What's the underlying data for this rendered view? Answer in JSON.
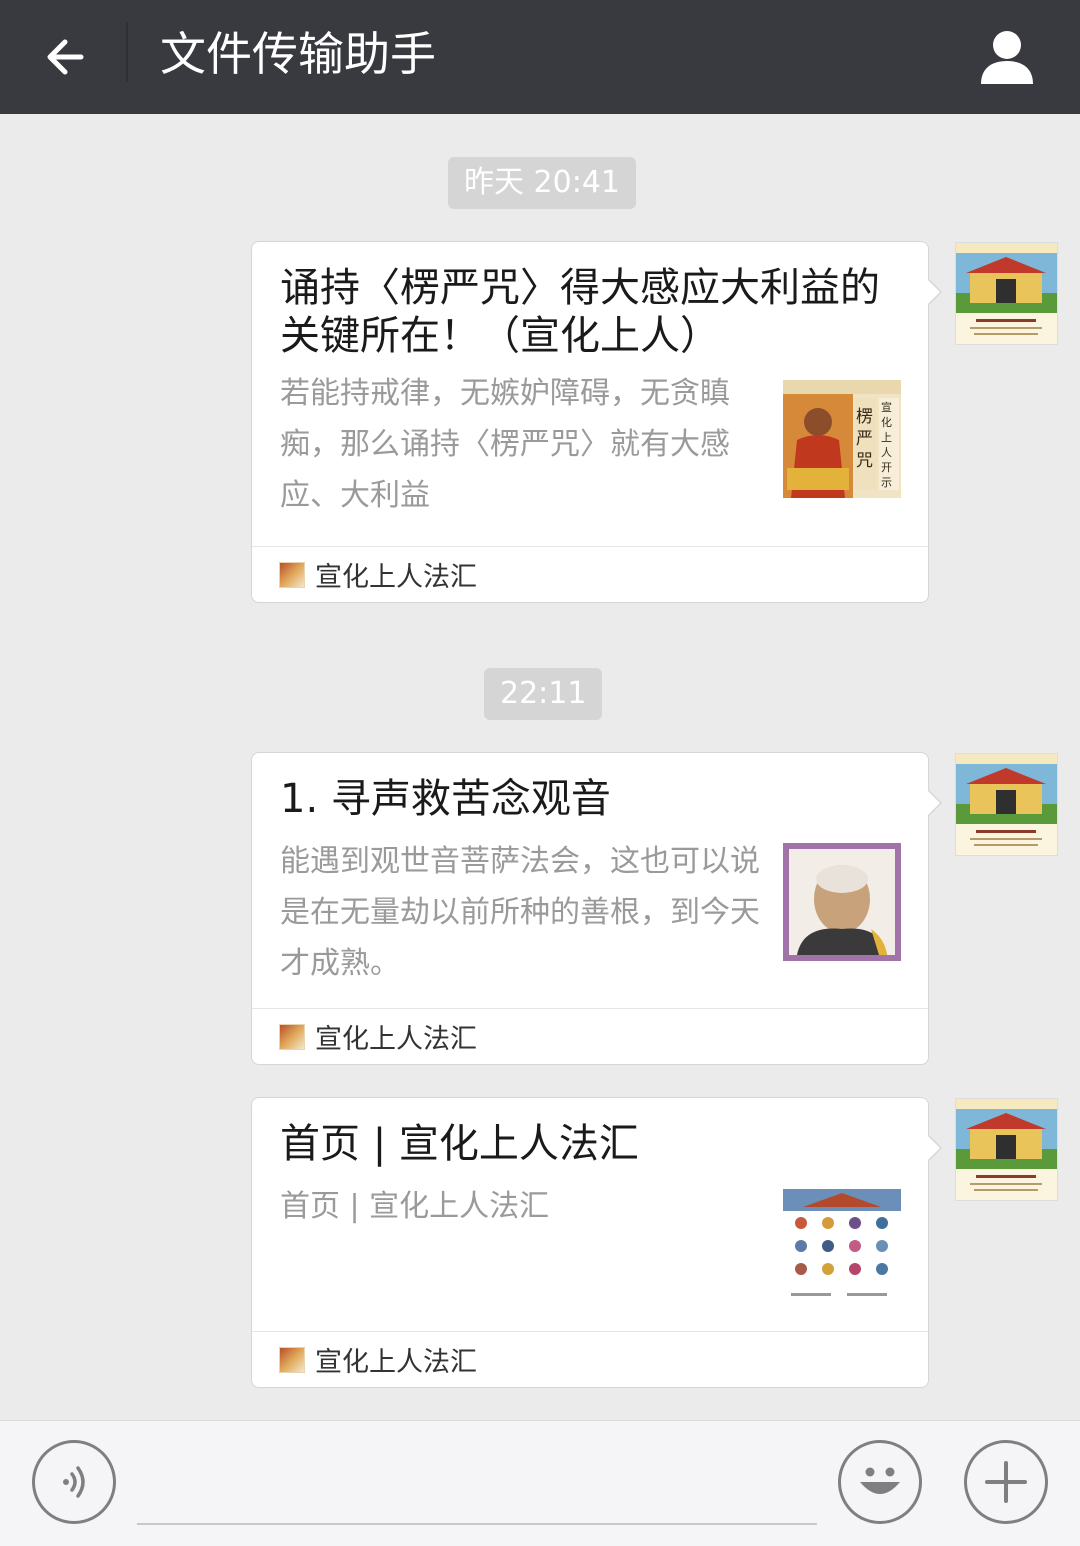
{
  "header": {
    "title": "文件传输助手",
    "back_icon": "arrow-left",
    "profile_icon": "person"
  },
  "timestamps": [
    "昨天 20:41",
    "22:11"
  ],
  "messages": [
    {
      "title": "诵持〈楞严咒〉得大感应大利益的关键所在！（宣化上人）",
      "description": "若能持戒律，无嫉妒障碍，无贪瞋痴，那么诵持〈楞严咒〉就有大感应、大利益",
      "source": "宣化上人法汇",
      "thumb_text": "楞严咒",
      "thumb_side_text": "宣化上人开示"
    },
    {
      "title": "1. 寻声救苦念观音",
      "description": "能遇到观世音菩萨法会，这也可以说是在无量劫以前所种的善根，到今天才成熟。",
      "source": "宣化上人法汇"
    },
    {
      "title": "首页 | 宣化上人法汇",
      "description": "首页 | 宣化上人法汇",
      "source": "宣化上人法汇"
    }
  ],
  "bottom_bar": {
    "voice_icon": "voice",
    "emoji_icon": "smiley",
    "more_icon": "plus"
  },
  "colors": {
    "topbar": "#393a3f",
    "background": "#ebebeb",
    "timestamp_bg": "#d5d5d5"
  }
}
